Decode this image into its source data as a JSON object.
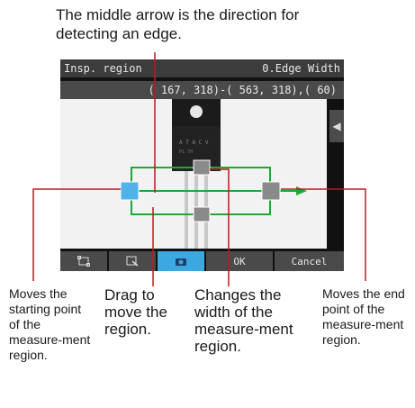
{
  "header_note": "The middle arrow is the direction for detecting an edge.",
  "screen": {
    "title_left": "Insp. region",
    "title_right": "0.Edge Width",
    "coords": "( 167, 318)-( 563, 318),( 60)",
    "side_arrow": "◀",
    "toolbar": {
      "btn1_icon": "frame-icon",
      "btn2_icon": "zoom-icon",
      "btn3_icon": "camera-icon",
      "ok": "OK",
      "cancel": "Cancel"
    }
  },
  "callouts": {
    "start": "Moves the starting point of the measure-ment region.",
    "drag": "Drag to move the region.",
    "width": "Changes the width of the measure-ment region.",
    "end": "Moves the end point of the measure-ment region."
  },
  "colors": {
    "region": "#1fa83a",
    "handle_start": "#4fb3e8",
    "handle_gray": "#8a8a8a",
    "leader": "#c01820",
    "active": "#3ca8e0"
  }
}
